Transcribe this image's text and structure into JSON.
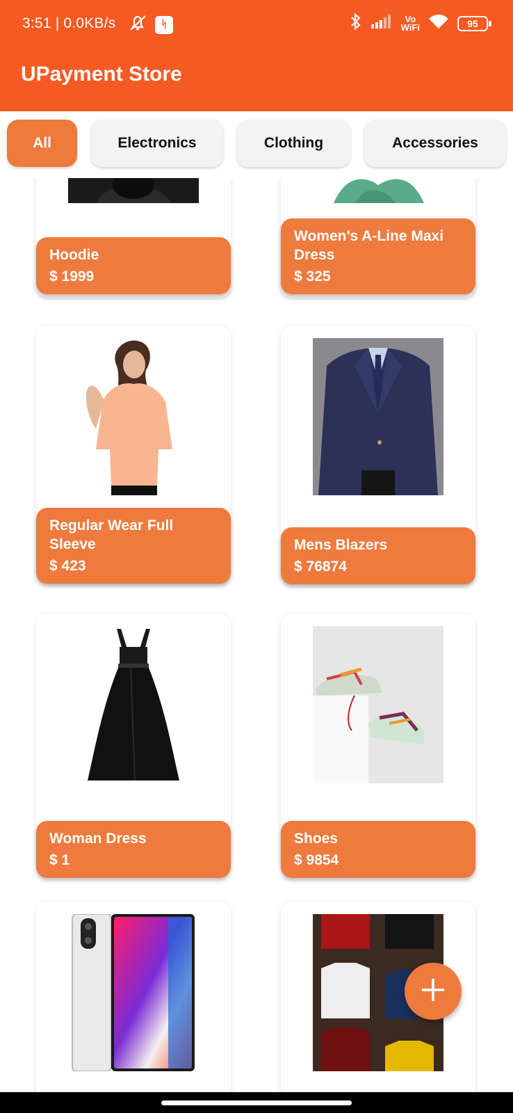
{
  "status_bar": {
    "time_speed": "3:51 | 0.0KB/s",
    "vowifi_top": "Vo",
    "vowifi_bottom": "WiFi",
    "battery": "95"
  },
  "app": {
    "title": "UPayment Store"
  },
  "categories": [
    {
      "label": "All",
      "active": true
    },
    {
      "label": "Electronics",
      "active": false
    },
    {
      "label": "Clothing",
      "active": false
    },
    {
      "label": "Accessories",
      "active": false
    }
  ],
  "products": [
    {
      "name": "Hoodie",
      "price": "$ 1999",
      "image": "hoodie-image"
    },
    {
      "name": "Women's A-Line Maxi Dress",
      "price": "$ 325",
      "image": "maxi-dress-image"
    },
    {
      "name": "Regular Wear Full Sleeve",
      "price": "$ 423",
      "image": "shirt-image"
    },
    {
      "name": "Mens Blazers",
      "price": "$ 76874",
      "image": "blazer-image"
    },
    {
      "name": "Woman Dress",
      "price": "$ 1",
      "image": "black-dress-image"
    },
    {
      "name": "Shoes",
      "price": "$ 9854",
      "image": "shoes-image"
    },
    {
      "name": "",
      "price": "",
      "image": "phone-image"
    },
    {
      "name": "",
      "price": "",
      "image": "tshirts-image"
    }
  ],
  "colors": {
    "primary": "#f55a22",
    "accent": "#ef7a3d"
  }
}
